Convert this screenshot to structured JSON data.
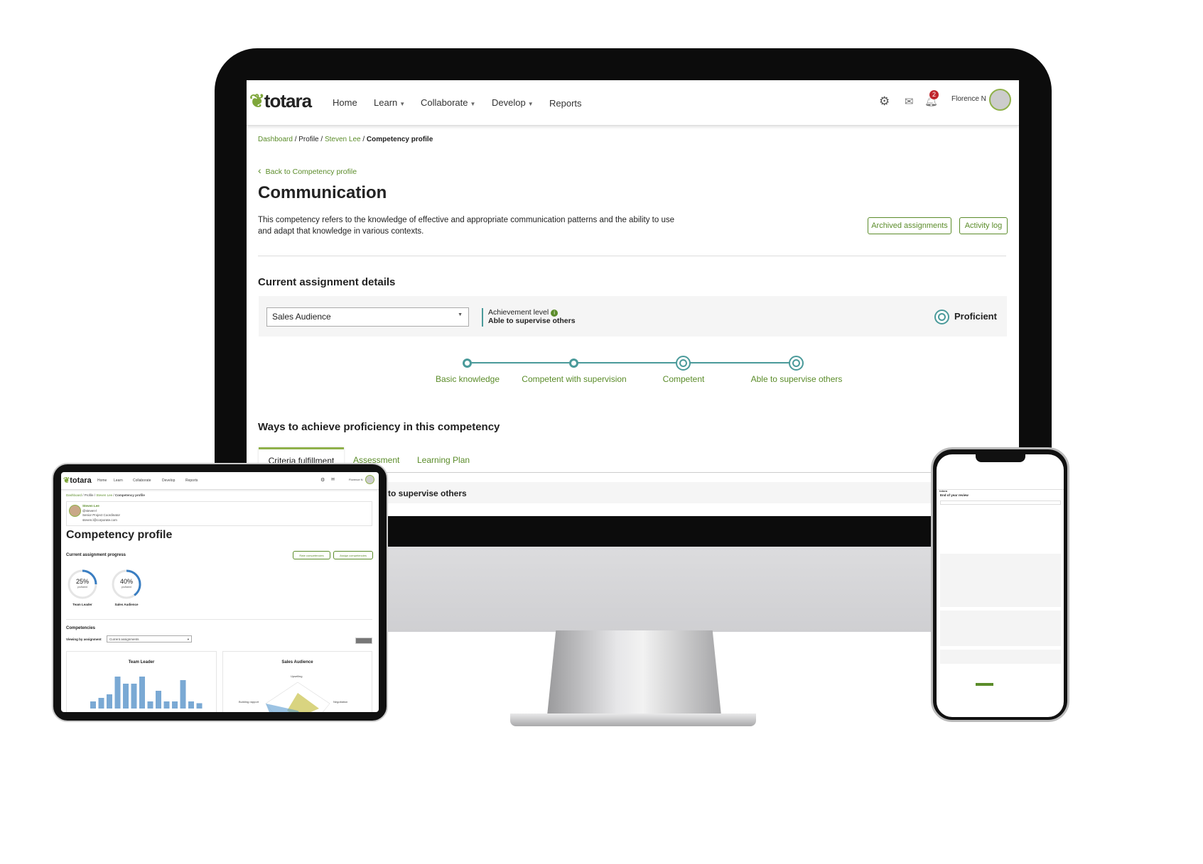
{
  "desktop": {
    "nav": {
      "logo": "totara",
      "items": [
        "Home",
        "Learn",
        "Collaborate",
        "Develop",
        "Reports"
      ],
      "user": "Florence N",
      "notification_count": "2"
    },
    "breadcrumb": {
      "items": [
        "Dashboard",
        "Profile",
        "Steven Lee"
      ],
      "current": "Competency profile"
    },
    "back_link": "Back to Competency profile",
    "title": "Communication",
    "description": "This competency refers to the knowledge of effective and appropriate communication patterns and the ability to use and adapt that knowledge in various contexts.",
    "buttons": {
      "archived": "Archived assignments",
      "activity": "Activity log"
    },
    "assignment": {
      "heading": "Current assignment details",
      "select_value": "Sales Audience",
      "achievement_label": "Achievement level",
      "achievement_value": "Able to supervise others",
      "status": "Proficient"
    },
    "scale": {
      "steps": [
        "Basic knowledge",
        "Competent with supervision",
        "Competent",
        "Able to supervise others"
      ],
      "achieved_index": 3,
      "proficient_from_index": 2
    },
    "ways": {
      "heading": "Ways to achieve proficiency in this competency",
      "tabs": [
        "Criteria fulfillment",
        "Assessment",
        "Learning Plan"
      ],
      "active_tab": 0,
      "section_title": "to supervise others"
    },
    "colors": {
      "brand": "#5b8c2a",
      "scale": "#4a9a9a"
    }
  },
  "tablet": {
    "nav": {
      "logo": "totara",
      "items": [
        "Home",
        "Learn",
        "Collaborate",
        "Develop",
        "Reports"
      ],
      "user": "Florence N"
    },
    "breadcrumb": {
      "items": [
        "Dashboard",
        "Profile",
        "Steven Lee"
      ],
      "current": "Competency profile"
    },
    "user": {
      "name": "Steven Lee",
      "username": "@steven-l",
      "role": "Senior Project Coordinator",
      "email": "steven.l@corporate.com"
    },
    "title": "Competency profile",
    "progress_heading": "Current assignment progress",
    "buttons": {
      "rate": "Rate competencies",
      "assign": "Assign competencies"
    },
    "progress": [
      {
        "value": 25,
        "label": "proficient",
        "name": "Team Leader"
      },
      {
        "value": 40,
        "label": "proficient",
        "name": "Sales Audience"
      }
    ],
    "competencies_heading": "Competencies",
    "viewing_label": "Viewing by assignment",
    "viewing_value": "Current assignments",
    "cards": [
      "Team Leader",
      "Sales Audience"
    ],
    "radar_labels": [
      "Upselling",
      "Building rapport",
      "Negotiation"
    ]
  },
  "phone": {
    "logo": "totara",
    "title": "End of year review"
  }
}
